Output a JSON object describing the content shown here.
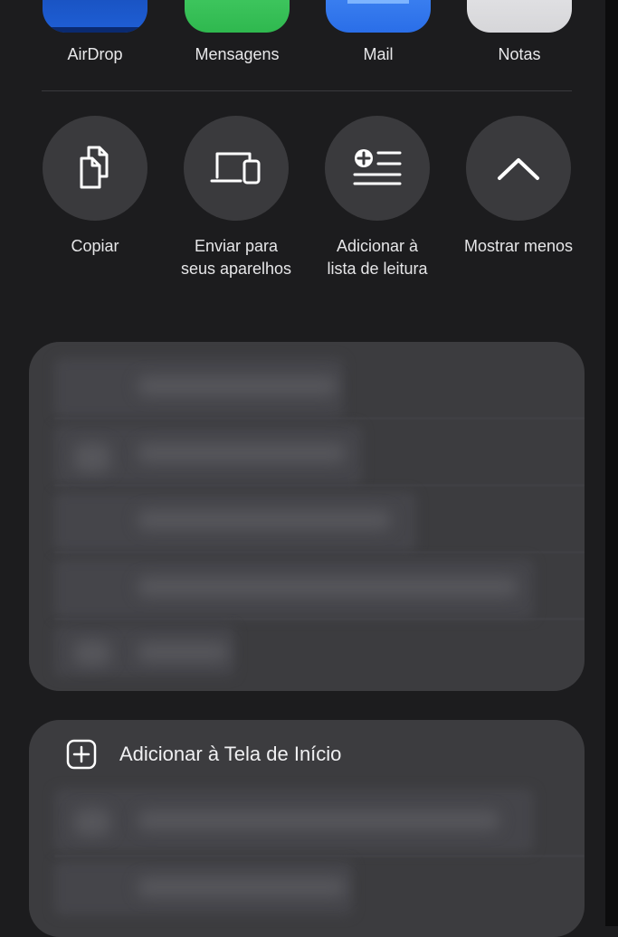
{
  "apps": [
    {
      "label": "AirDrop",
      "icon": "airdrop-icon",
      "color": "#1f5fd6"
    },
    {
      "label": "Mensagens",
      "icon": "messages-icon",
      "color": "#34c759"
    },
    {
      "label": "Mail",
      "icon": "mail-icon",
      "color": "#2f7cf6"
    },
    {
      "label": "Notas",
      "icon": "notes-icon",
      "color": "#e5e5e7"
    }
  ],
  "actions": [
    {
      "line1": "Copiar",
      "line2": "",
      "icon": "copy-icon"
    },
    {
      "line1": "Enviar para",
      "line2": "seus aparelhos",
      "icon": "devices-icon"
    },
    {
      "line1": "Adicionar à",
      "line2": "lista de leitura",
      "icon": "reading-list-icon"
    },
    {
      "line1": "Mostrar menos",
      "line2": "",
      "icon": "chevron-up-icon"
    }
  ],
  "home_screen": {
    "label": "Adicionar à Tela de Início",
    "icon": "add-square-icon"
  },
  "colors": {
    "background": "#1c1c1e",
    "circle": "#3a3a3d",
    "panel": "#3c3c3f"
  }
}
